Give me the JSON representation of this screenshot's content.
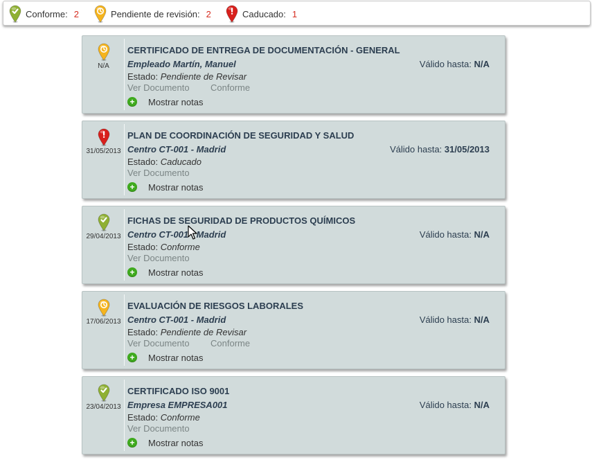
{
  "legend": {
    "items": [
      {
        "key": "ok",
        "label": "Conforme:",
        "count": "2",
        "icon": "check-pin-icon",
        "color": "#8fb033"
      },
      {
        "key": "pending",
        "label": "Pendiente de revisión:",
        "count": "2",
        "icon": "clock-pin-icon",
        "color": "#f5b41e"
      },
      {
        "key": "expired",
        "label": "Caducado:",
        "count": "1",
        "icon": "exclamation-pin-icon",
        "color": "#d8201c"
      }
    ]
  },
  "cards": [
    {
      "status_icon": "clock-pin-icon",
      "date": "N/A",
      "title": "CERTIFICADO DE ENTREGA DE DOCUMENTACIÓN - GENERAL",
      "owner": "Empleado Martín, Manuel",
      "valid_label": "Válido hasta:",
      "valid_value": "N/A",
      "state_label": "Estado:",
      "state_value": "Pendiente de Revisar",
      "doc_link": "Ver Documento",
      "approve_link": "Conforme",
      "notes_label": "Mostrar notas"
    },
    {
      "status_icon": "exclamation-pin-icon",
      "date": "31/05/2013",
      "title": "PLAN DE COORDINACIÓN DE SEGURIDAD Y SALUD",
      "owner": "Centro CT-001 - Madrid",
      "valid_label": "Válido hasta:",
      "valid_value": "31/05/2013",
      "state_label": "Estado:",
      "state_value": "Caducado",
      "doc_link": "Ver Documento",
      "approve_link": "",
      "notes_label": "Mostrar notas"
    },
    {
      "status_icon": "check-pin-icon",
      "date": "29/04/2013",
      "title": "FICHAS DE SEGURIDAD DE PRODUCTOS QUÍMICOS",
      "owner": "Centro CT-001 - Madrid",
      "valid_label": "Válido hasta:",
      "valid_value": "N/A",
      "state_label": "Estado:",
      "state_value": "Conforme",
      "doc_link": "Ver Documento",
      "approve_link": "",
      "notes_label": "Mostrar notas"
    },
    {
      "status_icon": "clock-pin-icon",
      "date": "17/06/2013",
      "title": "EVALUACIÓN DE RIESGOS LABORALES",
      "owner": "Centro CT-001 - Madrid",
      "valid_label": "Válido hasta:",
      "valid_value": "N/A",
      "state_label": "Estado:",
      "state_value": "Pendiente de Revisar",
      "doc_link": "Ver Documento",
      "approve_link": "Conforme",
      "notes_label": "Mostrar notas"
    },
    {
      "status_icon": "check-pin-icon",
      "date": "23/04/2013",
      "title": "CERTIFICADO ISO 9001",
      "owner": "Empresa EMPRESA001",
      "valid_label": "Válido hasta:",
      "valid_value": "N/A",
      "state_label": "Estado:",
      "state_value": "Conforme",
      "doc_link": "Ver Documento",
      "approve_link": "",
      "notes_label": "Mostrar notas"
    }
  ]
}
